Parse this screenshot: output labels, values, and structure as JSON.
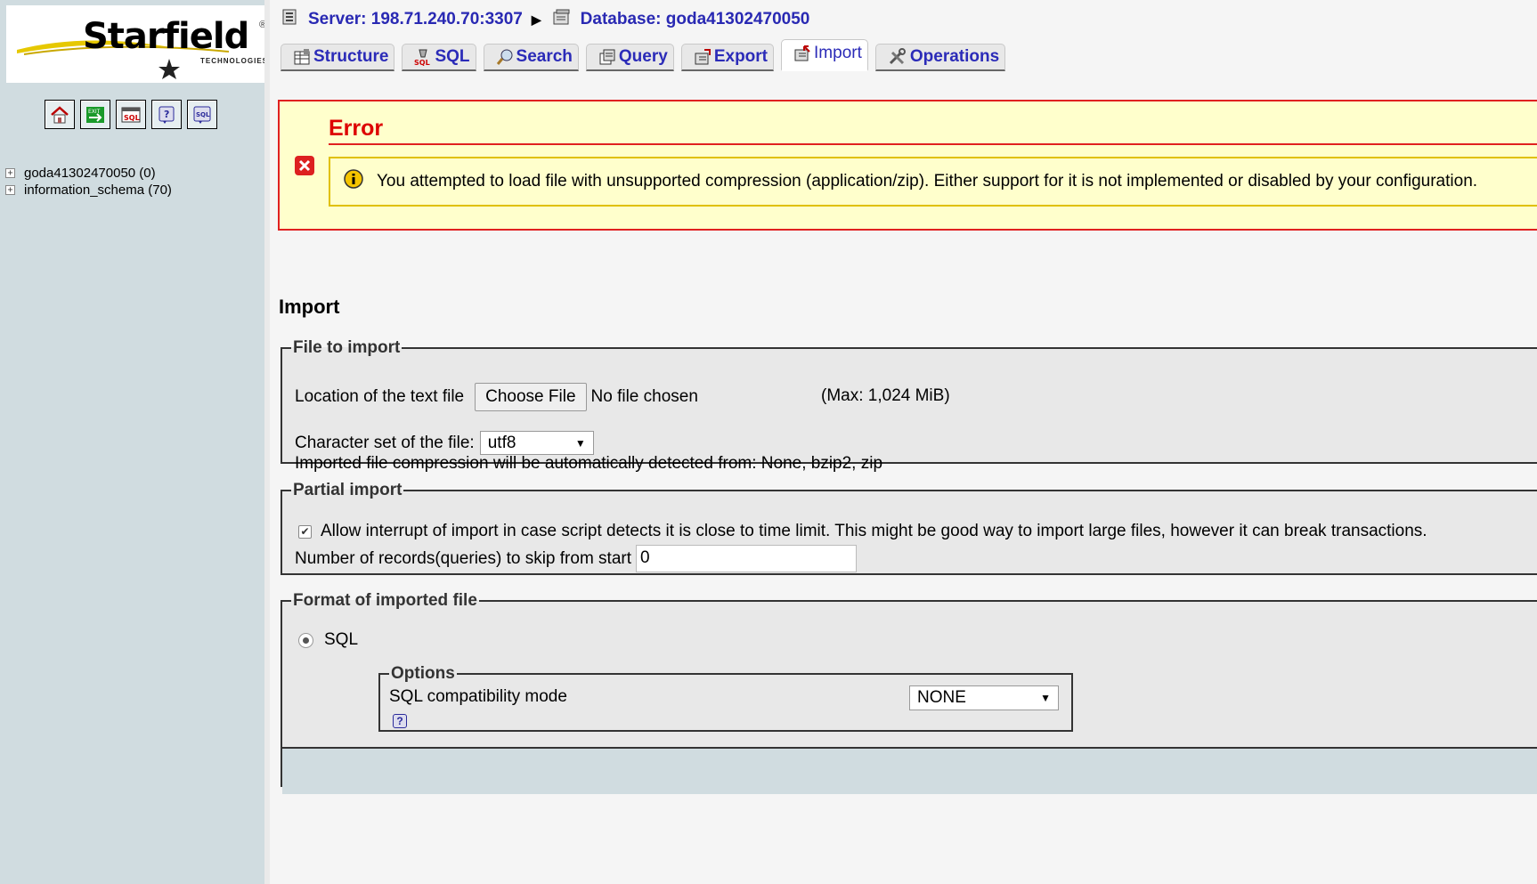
{
  "sidebar": {
    "logo": {
      "brand": "Starfield",
      "sub": "TECHNOLOGIES",
      "reg": "®"
    },
    "icons": [
      "home-icon",
      "exit-icon",
      "sql-icon",
      "docs-icon",
      "sql-docs-icon"
    ],
    "databases": [
      {
        "label": "goda41302470050 (0)"
      },
      {
        "label": "information_schema (70)"
      }
    ]
  },
  "breadcrumb": {
    "server": "Server: 198.71.240.70:3307",
    "database": "Database: goda41302470050"
  },
  "tabs": [
    {
      "label": "Structure"
    },
    {
      "label": "SQL"
    },
    {
      "label": "Search"
    },
    {
      "label": "Query"
    },
    {
      "label": "Export"
    },
    {
      "label": "Import",
      "active": true
    },
    {
      "label": "Operations"
    }
  ],
  "error": {
    "title": "Error",
    "message": "You attempted to load file with unsupported compression (application/zip). Either support for it is not implemented or disabled by your configuration."
  },
  "import": {
    "title": "Import",
    "file_section": {
      "legend": "File to import",
      "location_label": "Location of the text file",
      "choose_button": "Choose File",
      "no_file": "No file chosen",
      "max": "(Max: 1,024 MiB)",
      "charset_label": "Character set of the file:",
      "charset_value": "utf8",
      "compression_note": "Imported file compression will be automatically detected from: None, bzip2, zip"
    },
    "partial_section": {
      "legend": "Partial import",
      "allow_interrupt_label": "Allow interrupt of import in case script detects it is close to time limit. This might be good way to import large files, however it can break transactions.",
      "allow_interrupt_checked": true,
      "skip_label": "Number of records(queries) to skip from start",
      "skip_value": "0"
    },
    "format_section": {
      "legend": "Format of imported file",
      "format_label": "SQL",
      "options_legend": "Options",
      "compat_label": "SQL compatibility mode",
      "compat_value": "NONE",
      "help_glyph": "?"
    }
  },
  "colors": {
    "link": "#2b2bb8",
    "error_red": "#dd0000",
    "error_bg": "#ffffcc",
    "sidebar_bg": "#d0dce0"
  }
}
